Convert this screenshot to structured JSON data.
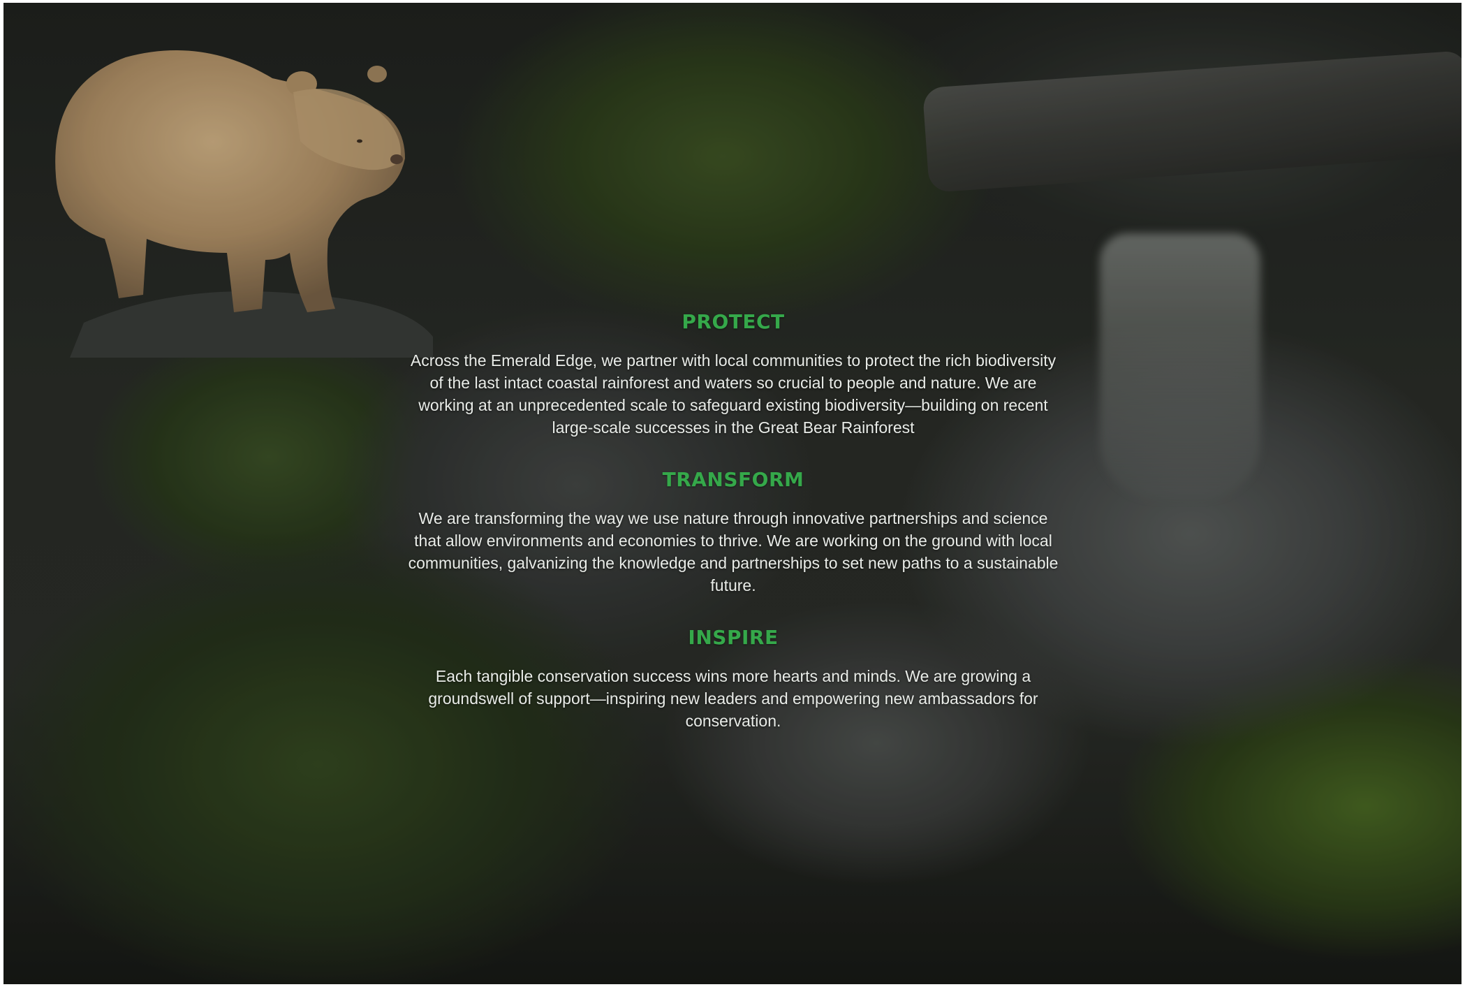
{
  "image": {
    "subject_icon": "bear-photo",
    "accent_color": "#35a84a",
    "text_color": "#e9ece8"
  },
  "sections": [
    {
      "heading": "PROTECT",
      "body": "Across the Emerald Edge, we partner with local communities to protect the rich biodiversity of the last intact coastal rainforest and waters so crucial to people and nature. We are working at an unprecedented scale to safeguard existing biodiversity—building on recent large-scale successes in the Great Bear Rainforest"
    },
    {
      "heading": "TRANSFORM",
      "body": "We are transforming the way we use nature through innovative partnerships and science that allow environments and economies to thrive. We are working on the ground with local communities, galvanizing the knowledge and partnerships to set new paths to a sustainable future."
    },
    {
      "heading": "INSPIRE",
      "body": "Each tangible conservation success wins more hearts and minds. We are growing a groundswell of support—inspiring new leaders and empowering new ambassadors for conservation."
    }
  ]
}
